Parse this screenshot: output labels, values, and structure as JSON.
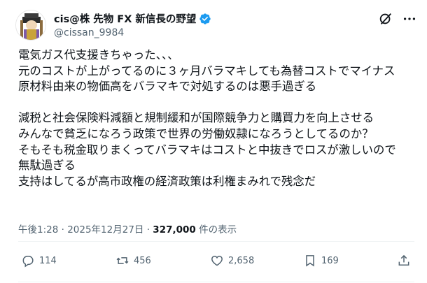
{
  "user": {
    "display_name": "cis@株 先物 FX 新信長の野望",
    "handle": "@cissan_9984",
    "verified_color": "#1d9bf0"
  },
  "post": {
    "lines": [
      "電気ガス代支援きちゃった、、、",
      "元のコストが上がってるのに３ヶ月バラマキしても為替コストでマイナス",
      "原材料由来の物価高をバラマキで対処するのは悪手過ぎる",
      "",
      "減税と社会保険料減額と規制緩和が国際競争力と購買力を向上させる",
      "みんなで貧乏になろう政策で世界の労働奴隷になろうとしてるのか？",
      "そもそも税金取りまくってバラマキはコストと中抜きでロスが激しいので",
      "無駄過ぎる",
      "支持はしてるが高市政権の経済政策は利権まみれで残念だ"
    ]
  },
  "meta": {
    "time": "午後1:28",
    "sep1": " · ",
    "date": "2025年12月27日",
    "sep2": " · ",
    "views": "327,000",
    "views_suffix": " 件の表示"
  },
  "actions": {
    "replies": "114",
    "reposts": "456",
    "likes": "2,658",
    "bookmarks": "169"
  },
  "icons": {
    "header": [
      "grok-icon",
      "more-icon"
    ],
    "actions": [
      "reply-icon",
      "repost-icon",
      "like-icon",
      "bookmark-icon",
      "share-icon"
    ]
  }
}
